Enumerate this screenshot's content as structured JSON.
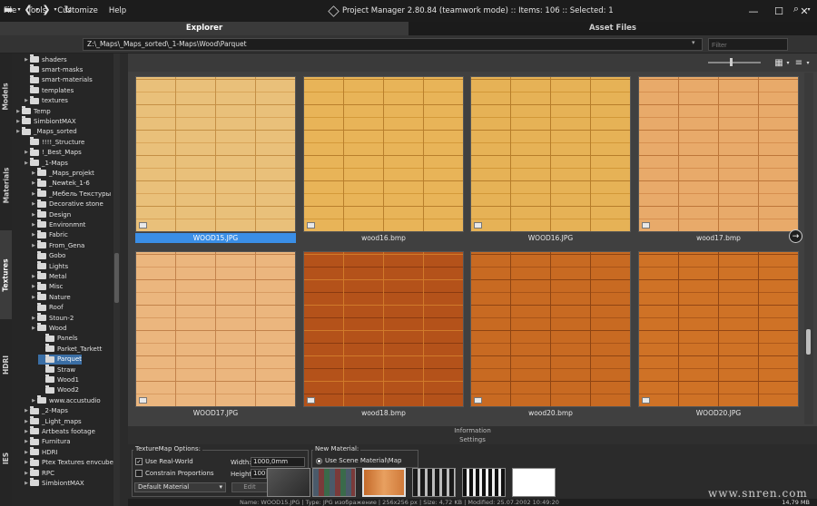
{
  "menu": [
    "File",
    "Tools",
    "Customize",
    "Help"
  ],
  "window": {
    "title": "Project Manager 2.80.84 (teamwork mode)  :: Items: 106  :: Selected: 1",
    "minimize": "—",
    "maximize": "☐",
    "close": "✕"
  },
  "tabs": {
    "explorer": "Explorer",
    "asset_files": "Asset Files"
  },
  "toolbar": {
    "path": "Z:\\_Maps\\_Maps_sorted\\_1-Maps\\Wood\\Parquet",
    "filter_placeholder": "Filter"
  },
  "side_tabs": [
    "Models",
    "Materials",
    "Textures",
    "HDRI",
    "IES"
  ],
  "tree": [
    {
      "label": "shaders",
      "level": 2,
      "expandable": true
    },
    {
      "label": "smart-masks",
      "level": 2,
      "expandable": false
    },
    {
      "label": "smart-materials",
      "level": 2,
      "expandable": false
    },
    {
      "label": "templates",
      "level": 2,
      "expandable": false
    },
    {
      "label": "textures",
      "level": 2,
      "expandable": true
    },
    {
      "label": "Temp",
      "level": 1,
      "expandable": true
    },
    {
      "label": "SimbiontMAX",
      "level": 1,
      "expandable": true
    },
    {
      "label": "_Maps_sorted",
      "level": 1,
      "expandable": true
    },
    {
      "label": "!!!!_Structure",
      "level": 2,
      "expandable": false
    },
    {
      "label": "!_Best_Maps",
      "level": 2,
      "expandable": true
    },
    {
      "label": "_1-Maps",
      "level": 2,
      "expandable": true
    },
    {
      "label": "_Maps_projekt",
      "level": 3,
      "expandable": true
    },
    {
      "label": "_Newtek_1-6",
      "level": 3,
      "expandable": true
    },
    {
      "label": "_Мебель Текстуры",
      "level": 3,
      "expandable": true
    },
    {
      "label": "Decorative stone",
      "level": 3,
      "expandable": true
    },
    {
      "label": "Design",
      "level": 3,
      "expandable": true
    },
    {
      "label": "Environmnt",
      "level": 3,
      "expandable": true
    },
    {
      "label": "Fabric",
      "level": 3,
      "expandable": true
    },
    {
      "label": "From_Gena",
      "level": 3,
      "expandable": true
    },
    {
      "label": "Gobo",
      "level": 3,
      "expandable": false
    },
    {
      "label": "Lights",
      "level": 3,
      "expandable": false
    },
    {
      "label": "Metal",
      "level": 3,
      "expandable": true
    },
    {
      "label": "Misc",
      "level": 3,
      "expandable": true
    },
    {
      "label": "Nature",
      "level": 3,
      "expandable": true
    },
    {
      "label": "Roof",
      "level": 3,
      "expandable": false
    },
    {
      "label": "Stoun-2",
      "level": 3,
      "expandable": true
    },
    {
      "label": "Wood",
      "level": 3,
      "expandable": true
    },
    {
      "label": "Panels",
      "level": 4,
      "expandable": false
    },
    {
      "label": "Parket_Tarkett",
      "level": 4,
      "expandable": false
    },
    {
      "label": "Parquet",
      "level": 4,
      "expandable": false,
      "selected": true
    },
    {
      "label": "Straw",
      "level": 4,
      "expandable": false
    },
    {
      "label": "Wood1",
      "level": 4,
      "expandable": false
    },
    {
      "label": "Wood2",
      "level": 4,
      "expandable": false
    },
    {
      "label": "www.accustudio",
      "level": 3,
      "expandable": true
    },
    {
      "label": "_2-Maps",
      "level": 2,
      "expandable": true
    },
    {
      "label": "_Light_maps",
      "level": 2,
      "expandable": true
    },
    {
      "label": "Artbeats footage",
      "level": 2,
      "expandable": true
    },
    {
      "label": "Furnitura",
      "level": 2,
      "expandable": true
    },
    {
      "label": "HDRI",
      "level": 2,
      "expandable": true
    },
    {
      "label": "Ptex Textures envcube",
      "level": 2,
      "expandable": true
    },
    {
      "label": "RPC",
      "level": 2,
      "expandable": true
    },
    {
      "label": "SimbiontMAX",
      "level": 2,
      "expandable": true
    }
  ],
  "thumbnails": [
    {
      "name": "WOOD15.JPG",
      "selected": true,
      "c1": "#e9c07a",
      "c2": "#d9a55a",
      "lines": "#c48f45",
      "badge": "JPG"
    },
    {
      "name": "wood16.bmp",
      "selected": false,
      "c1": "#e8b458",
      "c2": "#d49a3a",
      "lines": "#b97f2c",
      "badge": "BMP"
    },
    {
      "name": "WOOD16.JPG",
      "selected": false,
      "c1": "#e6b256",
      "c2": "#d29838",
      "lines": "#b77d2a",
      "badge": "JPG"
    },
    {
      "name": "wood17.bmp",
      "selected": false,
      "c1": "#e8aa6a",
      "c2": "#d68f4f",
      "lines": "#bd763a",
      "badge": "BMP"
    },
    {
      "name": "WOOD17.JPG",
      "selected": false,
      "c1": "#ebb67e",
      "c2": "#d89b62",
      "lines": "#c2824b",
      "badge": "JPG"
    },
    {
      "name": "wood18.bmp",
      "selected": false,
      "c1": "#b4521a",
      "c2": "#8a3a10",
      "lines": "#d07a2a",
      "badge": "BMP"
    },
    {
      "name": "wood20.bmp",
      "selected": false,
      "c1": "#c86a22",
      "c2": "#a85418",
      "lines": "#8e4412",
      "badge": "BMP"
    },
    {
      "name": "WOOD20.JPG",
      "selected": false,
      "c1": "#cf7226",
      "c2": "#ad581a",
      "lines": "#924614",
      "badge": "JPG"
    }
  ],
  "next_page_icon": "→",
  "panels": {
    "information": "Information",
    "settings": "Settings"
  },
  "texturemap": {
    "title": "TextureMap Options:",
    "use_real_world": "Use Real-World",
    "use_real_world_checked": "✓",
    "constrain_proportions": "Constrain Proportions",
    "width_label": "Width:",
    "width_value": "1000,0mm",
    "height_label": "Height:",
    "height_value": "100",
    "material_select": "Default Material",
    "edit_label": "Edit"
  },
  "new_material": {
    "title": "New Material:",
    "use_scene_material": "Use Scene Material\\Map"
  },
  "status": {
    "text": "Name: WOOD15.JPG | Type: JPG изображение | 256x256 px | Size: 4,72 KB | Modified: 25.07.2002 10:49:20",
    "memory": "14,79 MB"
  },
  "watermark": "www.snren.com"
}
